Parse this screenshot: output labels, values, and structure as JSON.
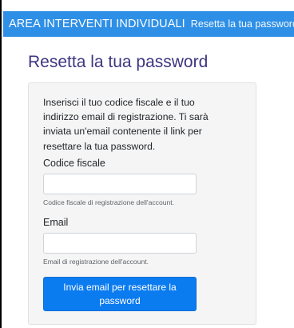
{
  "navbar": {
    "brand": "AREA INTERVENTI INDIVIDUALI",
    "link": "Resetta la tua password"
  },
  "page": {
    "title": "Resetta la tua password"
  },
  "form": {
    "intro": "Inserisci il tuo codice fiscale e il tuo indirizzo email di registrazione. Ti sarà inviata un'email contenente il link per resettare la tua password.",
    "codice_fiscale": {
      "label": "Codice fiscale",
      "value": "",
      "placeholder": "",
      "help": "Codice fiscale di registrazione dell'account."
    },
    "email": {
      "label": "Email",
      "value": "",
      "placeholder": "",
      "help": "Email di registrazione dell'account."
    },
    "submit_label": "Invia email per resettare la password"
  },
  "colors": {
    "navbar_bg": "#2e8fe6",
    "title_color": "#3d3580",
    "button_bg": "#0b7bf0",
    "card_bg": "#f5f5f5"
  }
}
